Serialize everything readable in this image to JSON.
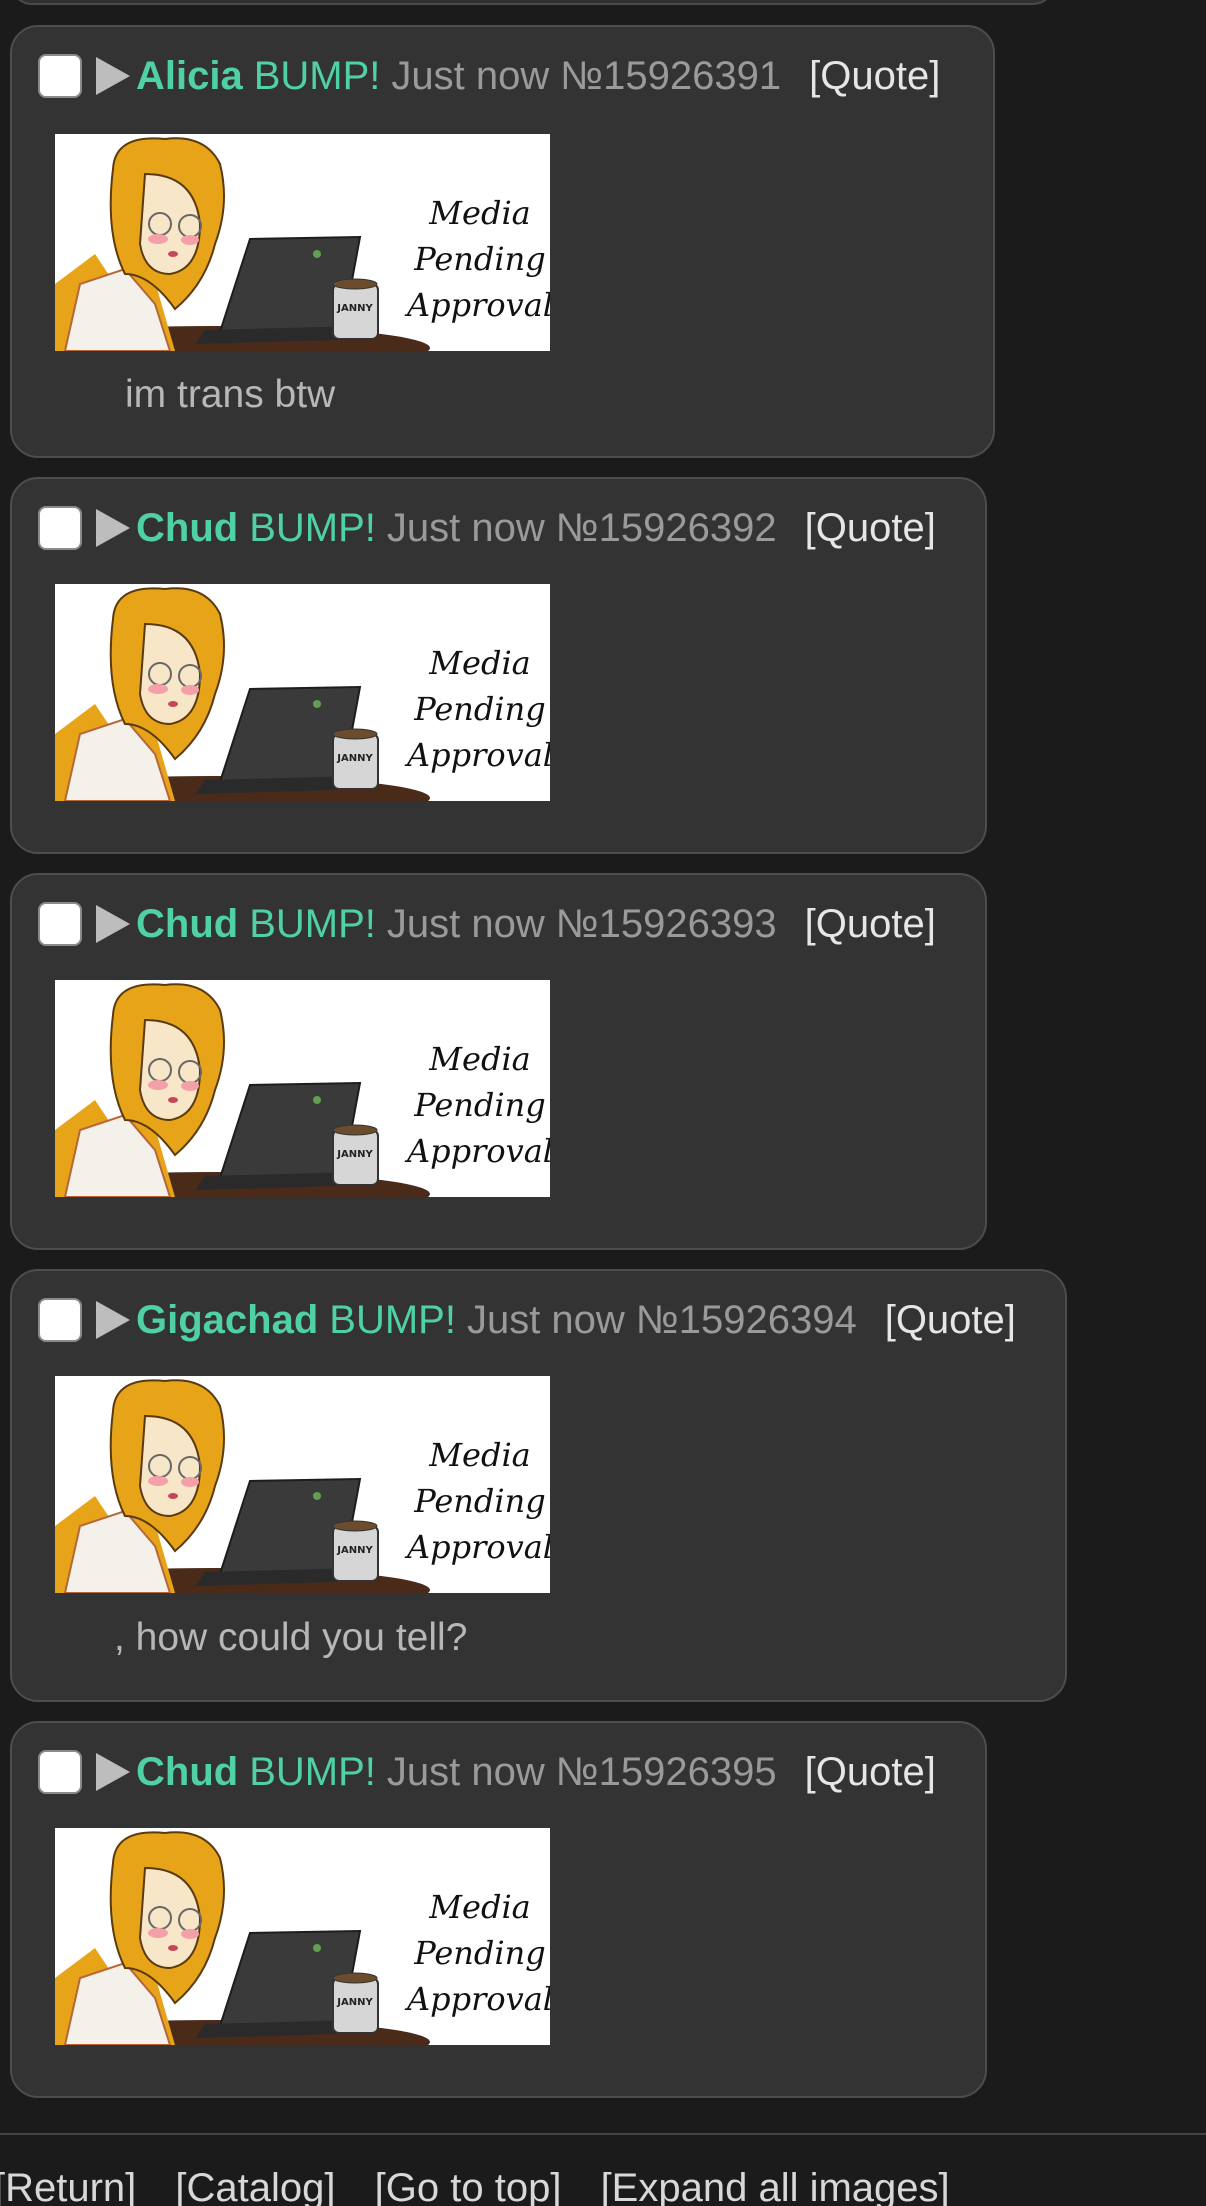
{
  "posts": [
    {
      "name": "Alicia",
      "bump": "BUMP!",
      "time": "Just now",
      "number": "№15926391",
      "quote_label": "[Quote]",
      "media_text": [
        "Media",
        "Pending",
        "Approval"
      ],
      "mug_text": "JANNY",
      "body": "im trans btw"
    },
    {
      "name": "Chud",
      "bump": "BUMP!",
      "time": "Just now",
      "number": "№15926392",
      "quote_label": "[Quote]",
      "media_text": [
        "Media",
        "Pending",
        "Approval"
      ],
      "mug_text": "JANNY",
      "body": ""
    },
    {
      "name": "Chud",
      "bump": "BUMP!",
      "time": "Just now",
      "number": "№15926393",
      "quote_label": "[Quote]",
      "media_text": [
        "Media",
        "Pending",
        "Approval"
      ],
      "mug_text": "JANNY",
      "body": ""
    },
    {
      "name": "Gigachad",
      "bump": "BUMP!",
      "time": "Just now",
      "number": "№15926394",
      "quote_label": "[Quote]",
      "media_text": [
        "Media",
        "Pending",
        "Approval"
      ],
      "mug_text": "JANNY",
      "body": ", how could you tell?"
    },
    {
      "name": "Chud",
      "bump": "BUMP!",
      "time": "Just now",
      "number": "№15926395",
      "quote_label": "[Quote]",
      "media_text": [
        "Media",
        "Pending",
        "Approval"
      ],
      "mug_text": "JANNY",
      "body": ""
    }
  ],
  "footer": {
    "return": "[Return]",
    "catalog": "[Catalog]",
    "go_to_top": "[Go to top]",
    "expand_all": "[Expand all images]"
  },
  "colors": {
    "background": "#1b1b1b",
    "post_background": "#333333",
    "name": "#4fd1a5",
    "muted": "#9a9a9a"
  }
}
